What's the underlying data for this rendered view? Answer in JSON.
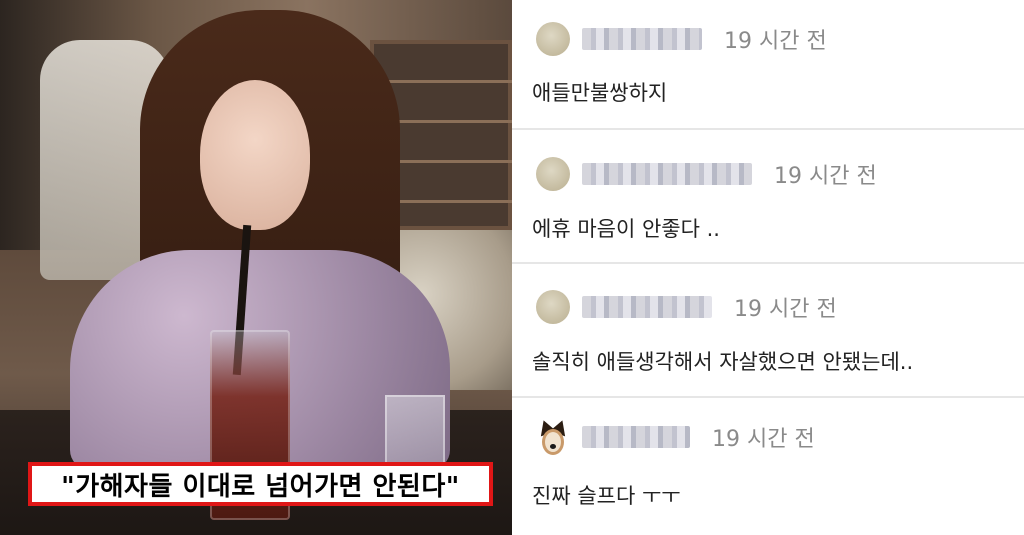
{
  "photo": {
    "caption": "\"가해자들 이대로 넘어가면 안된다\"",
    "caption_border_color": "#e01616"
  },
  "comments": [
    {
      "avatar_icon": "avatar-circle-icon",
      "time": "19 시간 전",
      "text": "애들만불쌍하지"
    },
    {
      "avatar_icon": "avatar-circle-icon",
      "time": "19 시간 전",
      "text": "에휴 마음이 안좋다 .."
    },
    {
      "avatar_icon": "avatar-circle-icon",
      "time": "19 시간 전",
      "text": "솔직히 애들생각해서 자살했으면 안됐는데.."
    },
    {
      "avatar_icon": "dog-avatar-icon",
      "time": "19 시간 전",
      "text": "진짜 슬프다 ㅜㅜ"
    }
  ]
}
